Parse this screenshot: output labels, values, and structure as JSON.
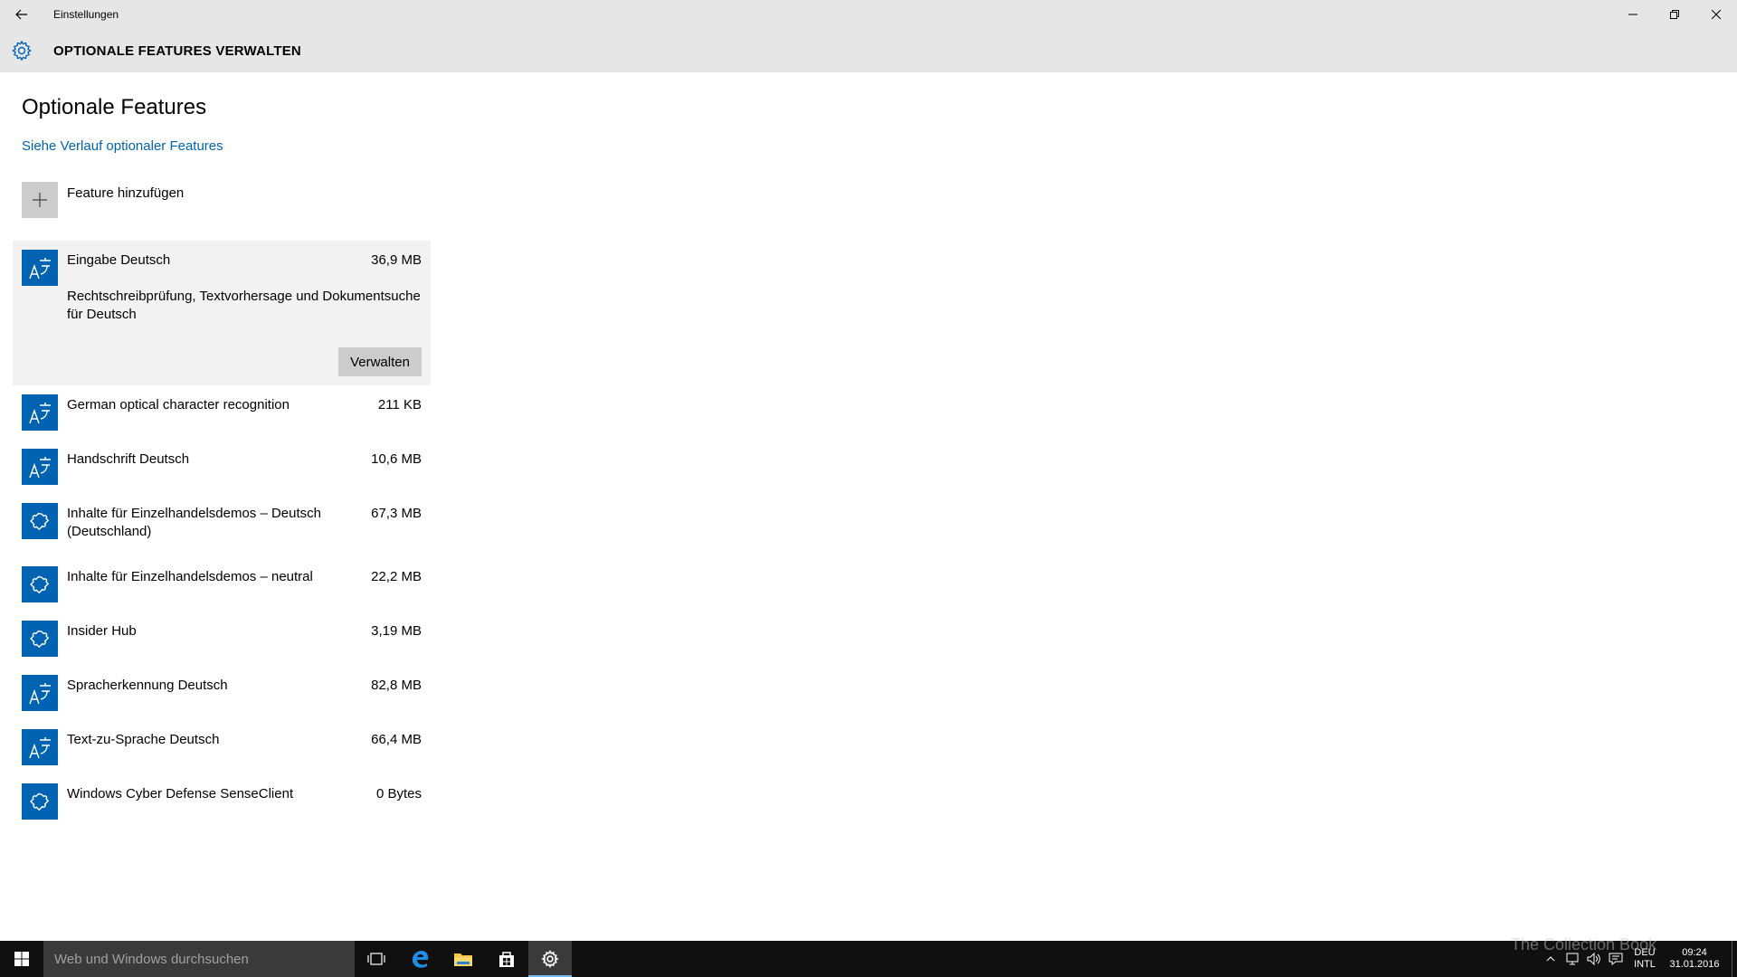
{
  "window": {
    "title": "Einstellungen",
    "header": "OPTIONALE FEATURES VERWALTEN"
  },
  "page": {
    "title": "Optionale Features",
    "history_link": "Siehe Verlauf optionaler Features",
    "add_feature": "Feature hinzufügen"
  },
  "features": [
    {
      "name": "Eingabe Deutsch",
      "size": "36,9 MB",
      "icon": "language-icon",
      "description": "Rechtschreibprüfung, Textvorhersage und Dokumentsuche für Deutsch",
      "manage_label": "Verwalten",
      "selected": true
    },
    {
      "name": "German optical character recognition",
      "size": "211 KB",
      "icon": "language-icon"
    },
    {
      "name": "Handschrift Deutsch",
      "size": "10,6 MB",
      "icon": "language-icon"
    },
    {
      "name": "Inhalte für Einzelhandelsdemos – Deutsch (Deutschland)",
      "size": "67,3 MB",
      "icon": "puzzle-icon"
    },
    {
      "name": "Inhalte für Einzelhandelsdemos – neutral",
      "size": "22,2 MB",
      "icon": "puzzle-icon"
    },
    {
      "name": "Insider Hub",
      "size": "3,19 MB",
      "icon": "puzzle-icon"
    },
    {
      "name": "Spracherkennung Deutsch",
      "size": "82,8 MB",
      "icon": "language-icon"
    },
    {
      "name": "Text-zu-Sprache Deutsch",
      "size": "66,4 MB",
      "icon": "language-icon"
    },
    {
      "name": "Windows Cyber Defense SenseClient",
      "size": "0 Bytes",
      "icon": "puzzle-icon"
    }
  ],
  "taskbar": {
    "search_placeholder": "Web und Windows durchsuchen",
    "lang_top": "DEU",
    "lang_bottom": "INTL",
    "time": "09:24",
    "date": "31.01.2016",
    "watermark": "The Collection Book"
  },
  "colors": {
    "accent": "#0063b1",
    "chrome": "#e6e6e6",
    "selected": "#f2f2f2",
    "taskbar": "#101010"
  }
}
